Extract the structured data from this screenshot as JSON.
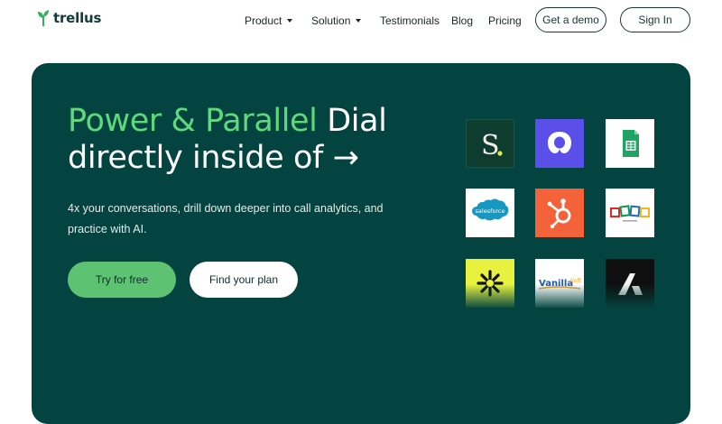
{
  "brand": {
    "name": "trellus",
    "color": "#2fb35a"
  },
  "nav": {
    "items": [
      {
        "label": "Product",
        "has_dropdown": true
      },
      {
        "label": "Solution",
        "has_dropdown": true
      },
      {
        "label": "Testimonials",
        "has_dropdown": false
      },
      {
        "label": "Blog",
        "has_dropdown": false
      },
      {
        "label": "Pricing",
        "has_dropdown": false
      }
    ],
    "demo_label": "Get a demo",
    "signin_label": "Sign In"
  },
  "hero": {
    "headline_accent": "Power & Parallel",
    "headline_rest_1": " Dial",
    "headline_line_2": "directly inside of →",
    "subtext": "4x your conversations, drill down deeper into call analytics, and practice with AI.",
    "primary_cta": "Try for free",
    "secondary_cta": "Find your plan",
    "background_color": "#034440",
    "accent_color": "#5fd97a"
  },
  "integrations": {
    "row1": [
      {
        "name": "salesloft",
        "letter": "S",
        "icon": "salesloft-icon"
      },
      {
        "name": "outreach",
        "icon": "outreach-icon"
      },
      {
        "name": "google-sheets",
        "icon": "sheets-icon"
      }
    ],
    "row2": [
      {
        "name": "salesforce",
        "text": "salesforce",
        "icon": "salesforce-icon"
      },
      {
        "name": "hubspot",
        "icon": "hubspot-icon"
      },
      {
        "name": "zoho",
        "icon": "zoho-icon"
      }
    ],
    "row3": [
      {
        "name": "apollo",
        "icon": "apollo-icon"
      },
      {
        "name": "vanillasoft",
        "text": "Vanilla",
        "text2": "Soft",
        "icon": "vanillasoft-icon"
      },
      {
        "name": "attio",
        "icon": "attio-icon"
      }
    ]
  }
}
